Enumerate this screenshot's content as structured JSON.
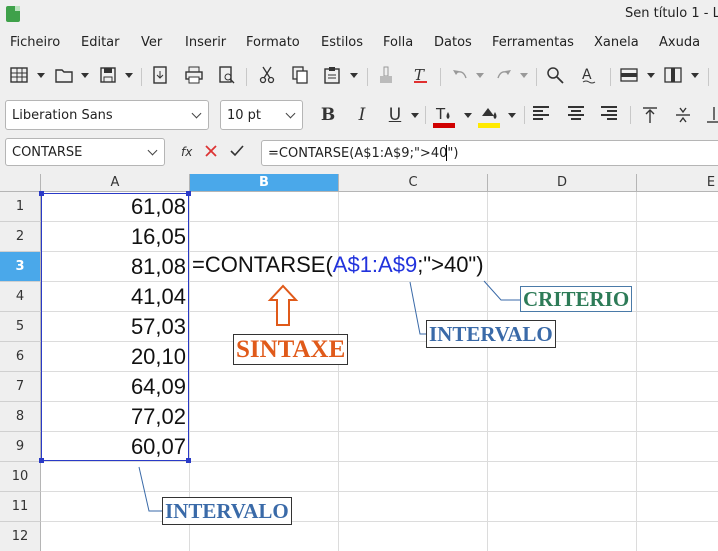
{
  "window": {
    "title": "Sen título 1 - L"
  },
  "menu": [
    "Ficheiro",
    "Editar",
    "Ver",
    "Inserir",
    "Formato",
    "Estilos",
    "Folla",
    "Datos",
    "Ferramentas",
    "Xanela",
    "Axuda"
  ],
  "format": {
    "font_name": "Liberation Sans",
    "font_size": "10 pt",
    "bold": "B",
    "italic": "I",
    "underline": "U",
    "font_color": "#d00000",
    "highlight_color": "#ffea00"
  },
  "formula_bar": {
    "name_box": "CONTARSE",
    "fx": "fx",
    "formula": "=CONTARSE(A$1:A$9;\">40\")"
  },
  "columns": [
    "A",
    "B",
    "C",
    "D",
    "E"
  ],
  "rows": [
    "1",
    "2",
    "3",
    "4",
    "5",
    "6",
    "7",
    "8",
    "9",
    "10",
    "11",
    "12"
  ],
  "cells_a": [
    "61,08",
    "16,05",
    "81,08",
    "41,04",
    "57,03",
    "20,10",
    "64,09",
    "77,02",
    "60,07"
  ],
  "formula_cell": {
    "prefix": "=CONTARSE(",
    "range": "A$1:A$9",
    "suffix": ";\">40\")"
  },
  "annotations": {
    "syntax": "SINTAXE",
    "interval_formula": "INTERVALO",
    "criterion": "CRITERIO",
    "interval_column": "INTERVALO"
  }
}
